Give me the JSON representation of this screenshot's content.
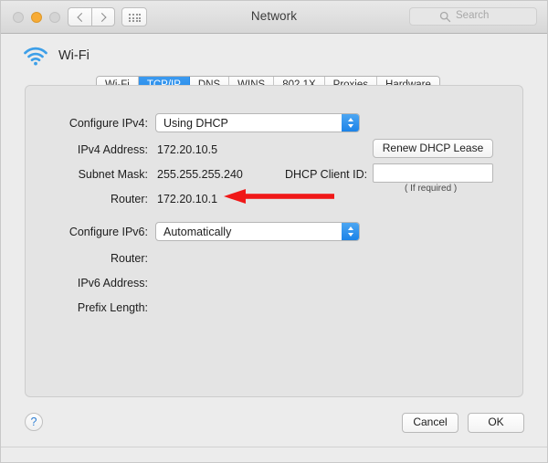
{
  "window": {
    "title": "Network",
    "traffic_lights": [
      "close",
      "minimize",
      "zoom"
    ],
    "search": {
      "placeholder": "Search",
      "value": ""
    }
  },
  "service": {
    "name": "Wi-Fi",
    "icon": "wifi-icon"
  },
  "tabs": [
    {
      "label": "Wi-Fi",
      "active": false
    },
    {
      "label": "TCP/IP",
      "active": true
    },
    {
      "label": "DNS",
      "active": false
    },
    {
      "label": "WINS",
      "active": false
    },
    {
      "label": "802.1X",
      "active": false
    },
    {
      "label": "Proxies",
      "active": false
    },
    {
      "label": "Hardware",
      "active": false
    }
  ],
  "ipv4": {
    "configure_label": "Configure IPv4:",
    "configure_value": "Using DHCP",
    "address_label": "IPv4 Address:",
    "address_value": "172.20.10.5",
    "subnet_label": "Subnet Mask:",
    "subnet_value": "255.255.255.240",
    "router_label": "Router:",
    "router_value": "172.20.10.1",
    "renew_button": "Renew DHCP Lease",
    "client_id_label": "DHCP Client ID:",
    "client_id_value": "",
    "client_id_hint": "( If required )"
  },
  "ipv6": {
    "configure_label": "Configure IPv6:",
    "configure_value": "Automatically",
    "router_label": "Router:",
    "router_value": "",
    "address_label": "IPv6 Address:",
    "address_value": "",
    "prefix_label": "Prefix Length:",
    "prefix_value": ""
  },
  "footer": {
    "help_label": "?",
    "cancel_label": "Cancel",
    "ok_label": "OK"
  },
  "annotation": {
    "type": "arrow",
    "direction": "left",
    "color": "#f01818",
    "points_at": "Router: 172.20.10.1"
  },
  "colors": {
    "accent_blue": "#1f86e8",
    "window_bg": "#ececec",
    "panel_bg": "#e4e4e4",
    "annotation_red": "#f01818",
    "minimize_orange": "#f7ab35"
  }
}
